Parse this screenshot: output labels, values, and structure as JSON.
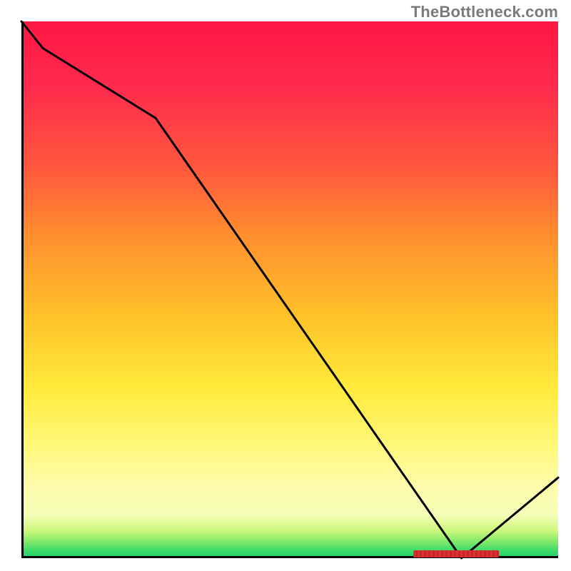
{
  "watermark": "TheBottleneck.com",
  "chart_data": {
    "type": "line",
    "x": [
      0.0,
      0.04,
      0.25,
      0.82,
      1.0
    ],
    "values": [
      1.0,
      0.95,
      0.82,
      0.0,
      0.15
    ],
    "xlabel": "",
    "ylabel": "",
    "ylim": [
      0,
      1
    ],
    "xlim": [
      0,
      1
    ],
    "gradient": {
      "top_color": "#ff1744",
      "mid_color": "#ffe93a",
      "bottom_color": "#1fd06a"
    },
    "axes": {
      "left_border": true,
      "bottom_border": true,
      "right_border": false,
      "top_border": false,
      "ticks": false
    },
    "marker": {
      "x_start": 0.73,
      "x_end": 0.89,
      "y": 0.005,
      "color": "#e02f2f"
    }
  }
}
